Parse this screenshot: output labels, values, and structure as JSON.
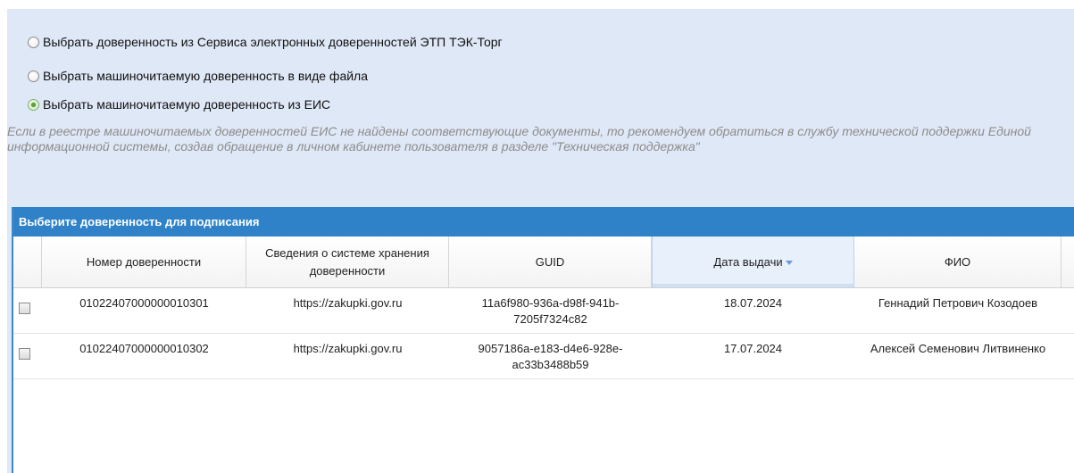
{
  "options": [
    {
      "label": "Выбрать доверенность из Сервиса электронных доверенностей ЭТП ТЭК-Торг",
      "checked": false
    },
    {
      "label": "Выбрать машиночитаемую доверенность в виде файла",
      "checked": false
    },
    {
      "label": "Выбрать машиночитаемую доверенность из ЕИС",
      "checked": true
    }
  ],
  "hint": "Если в реестре машиночитаемых доверенностей ЕИС не найдены соответствующие документы, то рекомендуем обратиться в службу технической поддержки Единой информационной системы, создав обращение в личном кабинете пользователя в разделе \"Техническая поддержка\"",
  "grid": {
    "title": "Выберите доверенность для подписания",
    "columns": {
      "number": "Номер доверенности",
      "storage": "Сведения о системе хранения доверенности",
      "guid": "GUID",
      "date": "Дата выдачи",
      "fio": "ФИО"
    },
    "sorted_column": "date",
    "sort_direction": "desc",
    "rows": [
      {
        "number": "01022407000000010301",
        "storage": "https://zakupki.gov.ru",
        "guid": "11a6f980-936a-d98f-941b-7205f7324c82",
        "date": "18.07.2024",
        "fio": "Геннадий Петрович Козодоев",
        "selected": false
      },
      {
        "number": "01022407000000010302",
        "storage": "https://zakupki.gov.ru",
        "guid": "9057186a-e183-d4e6-928e-ac33b3488b59",
        "date": "17.07.2024",
        "fio": "Алексей Семенович Литвиненко",
        "selected": false
      }
    ]
  },
  "colors": {
    "panel_bg": "#dfe8f6",
    "grid_header_bg": "#2f82c8",
    "hint_text": "#8c8c8c",
    "radio_checked": "#5aa23a"
  }
}
